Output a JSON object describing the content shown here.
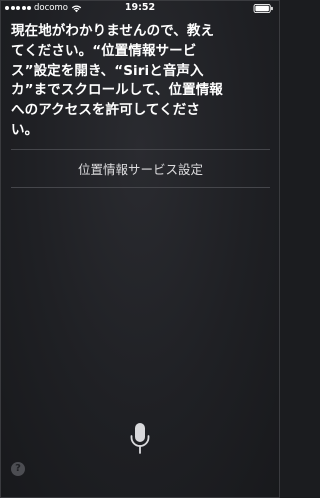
{
  "status_bar": {
    "carrier": "docomo",
    "time": "19:52"
  },
  "siri": {
    "message": "現在地がわかりませんので、教え\nてください。“位置情報サービ\nス”設定を開き、“Siriと音声入\nカ”までスクロールして、位置情報\nへのアクセスを許可してくださ\nい。",
    "settings_button_label": "位置情報サービス設定"
  },
  "controls": {
    "help_label": "?"
  },
  "icons": {
    "signal": "signal-dots-icon",
    "wifi": "wifi-icon",
    "battery": "battery-icon",
    "microphone": "microphone-icon",
    "help": "question-mark-icon"
  },
  "colors": {
    "background": "#1f2024",
    "text": "#ffffff",
    "divider": "#45464b",
    "button_text": "#dcdcde"
  }
}
